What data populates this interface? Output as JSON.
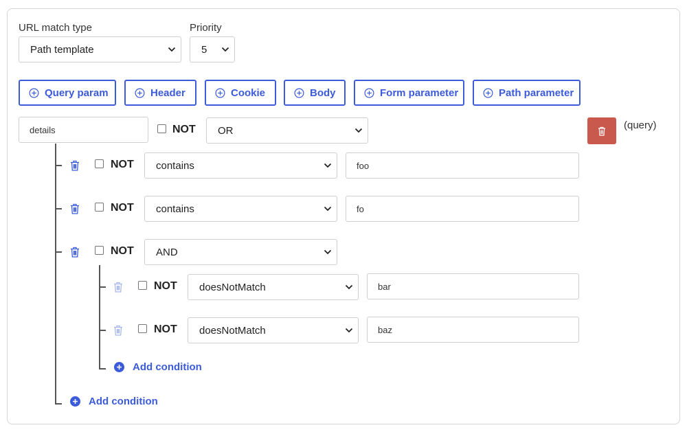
{
  "url_match": {
    "label": "URL match type",
    "value": "Path template"
  },
  "priority": {
    "label": "Priority",
    "value": "5"
  },
  "add_buttons": [
    "Query param",
    "Header",
    "Cookie",
    "Body",
    "Form parameter",
    "Path parameter"
  ],
  "root": {
    "name_value": "details",
    "not_label": "NOT",
    "operator": "OR",
    "type_tag": "(query)"
  },
  "conditions": [
    {
      "not_label": "NOT",
      "operator": "contains",
      "value": "foo"
    },
    {
      "not_label": "NOT",
      "operator": "contains",
      "value": "fo"
    },
    {
      "not_label": "NOT",
      "operator": "AND"
    }
  ],
  "nested_conditions": [
    {
      "not_label": "NOT",
      "operator": "doesNotMatch",
      "value": "bar"
    },
    {
      "not_label": "NOT",
      "operator": "doesNotMatch",
      "value": "baz"
    }
  ],
  "add_condition_label": "Add condition",
  "colors": {
    "accent": "#3b5bdb",
    "danger": "#c9594d",
    "trash_blue": "#3b5bdb",
    "trash_light": "#a9b8ec"
  }
}
